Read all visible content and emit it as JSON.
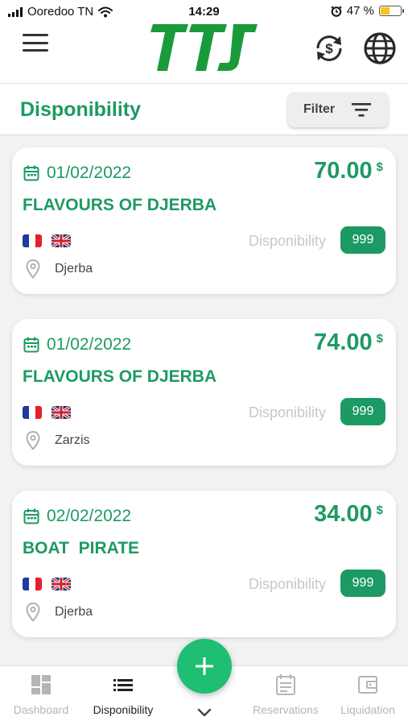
{
  "status_bar": {
    "carrier": "Ooredoo TN",
    "time": "14:29",
    "battery": "47 %",
    "battery_level": 0.47
  },
  "header": {
    "logo_text": "TTS",
    "icons": [
      "menu-icon",
      "currency-exchange-icon",
      "globe-icon"
    ]
  },
  "page": {
    "title": "Disponibility",
    "filter_label": "Filter"
  },
  "cards": [
    {
      "date": "01/02/2022",
      "price": "70.00",
      "currency": "$",
      "name": "FLAVOURS OF DJERBA",
      "dispo_label": "Disponibility",
      "dispo_count": "999",
      "location": "Djerba"
    },
    {
      "date": "01/02/2022",
      "price": "74.00",
      "currency": "$",
      "name": "FLAVOURS OF DJERBA",
      "dispo_label": "Disponibility",
      "dispo_count": "999",
      "location": "Zarzis"
    },
    {
      "date": "02/02/2022",
      "price": "34.00",
      "currency": "$",
      "name": "BOAT  PIRATE",
      "dispo_label": "Disponibility",
      "dispo_count": "999",
      "location": "Djerba"
    }
  ],
  "bottom_nav": {
    "items": [
      {
        "label": "Dashboard",
        "icon": "dashboard-icon"
      },
      {
        "label": "Disponibility",
        "icon": "list-icon"
      },
      {
        "label": "Reservations",
        "icon": "reservations-icon"
      },
      {
        "label": "Liquidation",
        "icon": "wallet-icon"
      }
    ],
    "fab_icon": "plus-icon"
  },
  "colors": {
    "brand_green": "#1d9a63",
    "fab_green": "#1fbf73",
    "battery_yellow": "#f5c518"
  }
}
